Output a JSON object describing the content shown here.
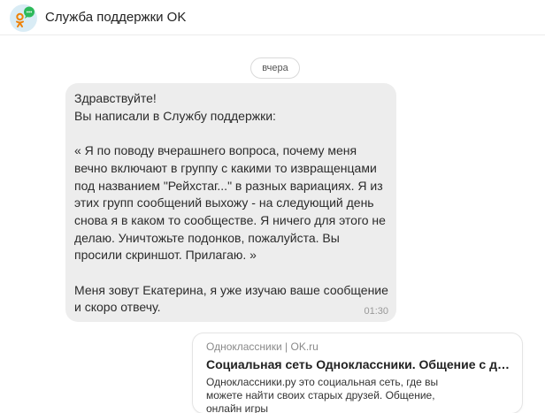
{
  "header": {
    "title": "Служба поддержки OK",
    "avatar_icon": "ok-support-logo-icon",
    "colors": {
      "avatar_bg": "#d9ecf5",
      "bubble_icon": "#2dba5a",
      "ok_logo": "#ee8208"
    }
  },
  "chat": {
    "date_label": "вчера",
    "message": {
      "text": "Здравствуйте!\nВы написали в Службу поддержки:\n\n« Я по поводу вчерашнего вопроса, почему меня вечно включают в группу с какими то извращенцами под названием \"Рейхстаг...\" в разных вариациях. Я из этих групп сообщений выхожу - на следующий день снова я в каком то сообществе. Я ничего для этого не делаю. Уничтожьте подонков, пожалуйста. Вы просили скриншот. Прилагаю. »\n\nМеня зовут Екатерина, я уже изучаю ваше сообщение и скоро отвечу.",
      "time": "01:30"
    },
    "link_preview": {
      "site": "Одноклассники | OK.ru",
      "title": "Социальная сеть Одноклассники. Общение с друзьями в ОК.",
      "description": "Одноклассники.ру это социальная сеть, где вы можете найти своих старых друзей. Общение, онлайн игры"
    }
  }
}
